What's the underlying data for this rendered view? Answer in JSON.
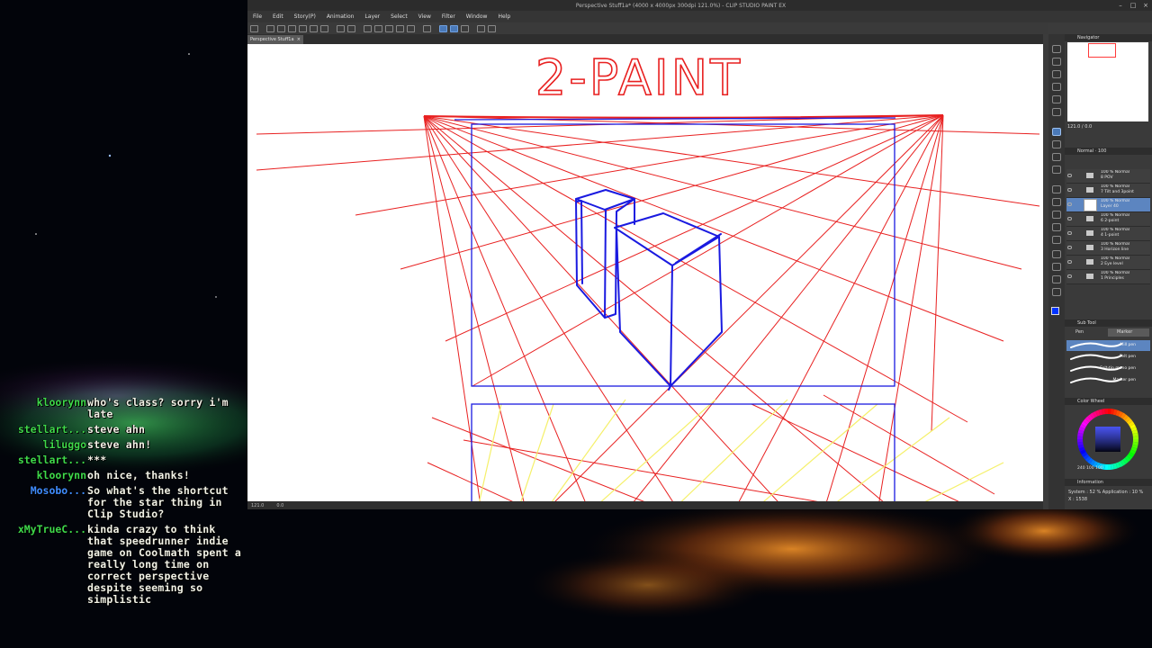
{
  "chat": [
    {
      "user": "kloorynn",
      "message": "who's class? sorry i'm late",
      "color": "#3ed84a"
    },
    {
      "user": "stellart...",
      "message": "steve ahn",
      "color": "#3ed84a"
    },
    {
      "user": "liluggo",
      "message": "steve ahn!",
      "color": "#3ed84a"
    },
    {
      "user": "stellart...",
      "message": "***",
      "color": "#3ed84a"
    },
    {
      "user": "kloorynn",
      "message": "oh nice, thanks!",
      "color": "#3ed84a"
    },
    {
      "user": "Mosobo...",
      "message": "So what's the shortcut for the star thing in Clip Studio?",
      "color": "#3f8cff"
    },
    {
      "user": "xMyTrueC...",
      "message": "kinda crazy to think that speedrunner indie game on Coolmath spent a really long time on correct perspective despite seeming so simplistic",
      "color": "#3ed84a"
    }
  ],
  "window": {
    "title": "Perspective Stuff1a* (4000 x 4000px 300dpi 121.0%) - CLIP STUDIO PAINT EX",
    "controls": [
      "–",
      "□",
      "×"
    ]
  },
  "menu": [
    "File",
    "Edit",
    "Story(P)",
    "Animation",
    "Layer",
    "Select",
    "View",
    "Filter",
    "Window",
    "Help"
  ],
  "document_tab": {
    "label": "Perspective Stuff1a",
    "close": "×"
  },
  "canvas": {
    "title_text": "2-PAINT",
    "ink_red": "#e82020",
    "ink_blue": "#1a1ae0",
    "ink_yellow": "#f5f06a"
  },
  "statusbar": {
    "zoom": "121.0",
    "angle": "0.0"
  },
  "navigator": {
    "header": "Navigator",
    "zoom": "121.0",
    "angle": "0.0"
  },
  "layer_panel": {
    "blend": "Normal",
    "opacity": "100",
    "layers": [
      {
        "percent": "100 %",
        "mode": "Normal",
        "name": "8 POV",
        "kind": "folder"
      },
      {
        "percent": "100 %",
        "mode": "Normal",
        "name": "7 Tilt and 3point",
        "kind": "folder"
      },
      {
        "percent": "100 %",
        "mode": "Normal",
        "name": "Layer 40",
        "kind": "raster",
        "selected": true
      },
      {
        "percent": "100 %",
        "mode": "Normal",
        "name": "6 2-point",
        "kind": "folder"
      },
      {
        "percent": "100 %",
        "mode": "Normal",
        "name": "4 1-point",
        "kind": "folder"
      },
      {
        "percent": "100 %",
        "mode": "Normal",
        "name": "3 Horizon line",
        "kind": "folder"
      },
      {
        "percent": "100 %",
        "mode": "Normal",
        "name": "2 Eye level",
        "kind": "folder"
      },
      {
        "percent": "100 %",
        "mode": "Normal",
        "name": "1 Principles",
        "kind": "folder"
      }
    ]
  },
  "subtool": {
    "header": "Sub Tool",
    "tabs": [
      "Pen",
      "Marker"
    ],
    "brushes": [
      "Mill pen",
      "Felt pen",
      "Felt-tip mono pen",
      "Marker pen"
    ]
  },
  "color_wheel": {
    "header": "Color Wheel",
    "values": "240 100 100",
    "main_color": "#0033ff"
  },
  "info": {
    "header": "Information",
    "system": "System : 52 %   Application : 10 %",
    "coords": "X : 1538"
  }
}
